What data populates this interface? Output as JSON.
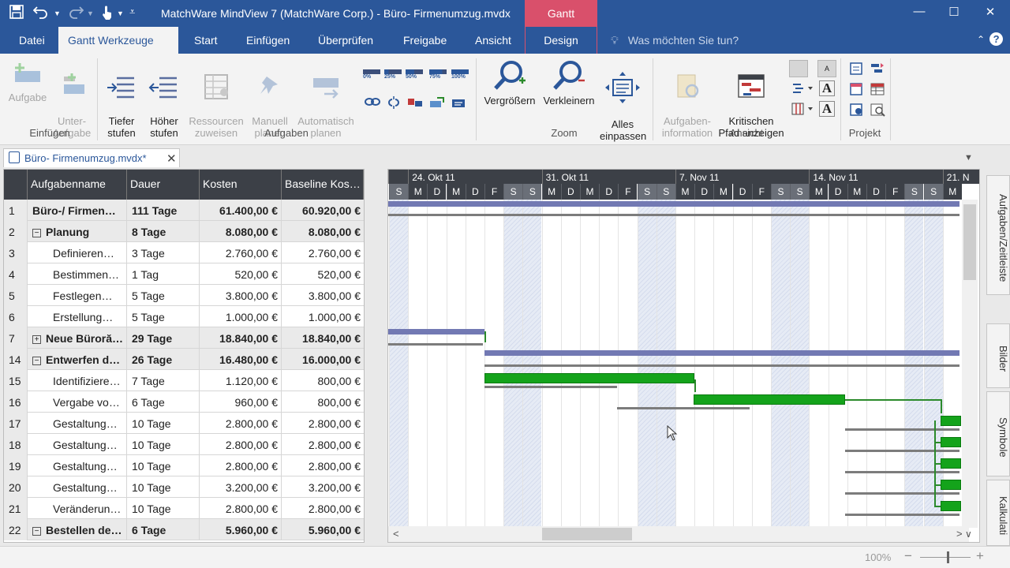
{
  "window": {
    "title": "MatchWare MindView 7 (MatchWare Corp.) - Büro- Firmenumzug.mvdx",
    "context_tab": "Gantt"
  },
  "ribbon_tabs": [
    "Datei",
    "Gantt Werkzeuge",
    "Start",
    "Einfügen",
    "Überprüfen",
    "Freigabe",
    "Ansicht",
    "Design"
  ],
  "active_tab": "Gantt Werkzeuge",
  "tell_me": "Was möchten Sie tun?",
  "ribbon": {
    "insert": {
      "label": "Einfügen",
      "task": "Aufgabe",
      "subtask": "Unter-\nAufgabe"
    },
    "tasks": {
      "label": "Aufgaben",
      "indent": "Tiefer\nstufen",
      "outdent": "Höher\nstufen",
      "assign": "Ressourcen\nzuweisen",
      "manual": "Manuell\nplanen",
      "auto": "Automatisch\nplanen",
      "progress": [
        "0%",
        "25%",
        "50%",
        "75%",
        "100%"
      ]
    },
    "zoom": {
      "label": "Zoom",
      "zoom_in": "Vergrößern",
      "zoom_out": "Verkleinern",
      "fit": "Alles\neinpassen"
    },
    "view": {
      "label": "Ansicht",
      "task_info": "Aufgaben-\ninformation",
      "critical": "Kritischen\nPfad anzeigen"
    },
    "project": {
      "label": "Projekt"
    }
  },
  "document_tab": "Büro- Firmenumzug.mvdx*",
  "grid": {
    "headers": [
      "Aufgabenname",
      "Dauer",
      "Kosten",
      "Baseline  Kos…"
    ],
    "rows": [
      {
        "id": "1",
        "name": "Büro-/ Firmen…",
        "duration": "111 Tage",
        "cost": "61.400,00 €",
        "baseline": "60.920,00 €",
        "summary": true,
        "exp": ""
      },
      {
        "id": "2",
        "name": "Planung",
        "duration": "8 Tage",
        "cost": "8.080,00 €",
        "baseline": "8.080,00 €",
        "summary": true,
        "exp": "−"
      },
      {
        "id": "3",
        "name": "Definieren…",
        "duration": "3 Tage",
        "cost": "2.760,00 €",
        "baseline": "2.760,00 €",
        "summary": false,
        "exp": ""
      },
      {
        "id": "4",
        "name": "Bestimmen…",
        "duration": "1 Tag",
        "cost": "520,00 €",
        "baseline": "520,00 €",
        "summary": false,
        "exp": ""
      },
      {
        "id": "5",
        "name": "Festlegen…",
        "duration": "5 Tage",
        "cost": "3.800,00 €",
        "baseline": "3.800,00 €",
        "summary": false,
        "exp": ""
      },
      {
        "id": "6",
        "name": "Erstellung…",
        "duration": "5 Tage",
        "cost": "1.000,00 €",
        "baseline": "1.000,00 €",
        "summary": false,
        "exp": ""
      },
      {
        "id": "7",
        "name": "Neue Büroră…",
        "duration": "29 Tage",
        "cost": "18.840,00 €",
        "baseline": "18.840,00 €",
        "summary": true,
        "exp": "+"
      },
      {
        "id": "14",
        "name": "Entwerfen d…",
        "duration": "26 Tage",
        "cost": "16.480,00 €",
        "baseline": "16.000,00 €",
        "summary": true,
        "exp": "−"
      },
      {
        "id": "15",
        "name": "Identifiziere…",
        "duration": "7 Tage",
        "cost": "1.120,00 €",
        "baseline": "800,00 €",
        "summary": false,
        "exp": ""
      },
      {
        "id": "16",
        "name": "Vergabe vo…",
        "duration": "6 Tage",
        "cost": "960,00 €",
        "baseline": "800,00 €",
        "summary": false,
        "exp": ""
      },
      {
        "id": "17",
        "name": "Gestaltung…",
        "duration": "10 Tage",
        "cost": "2.800,00 €",
        "baseline": "2.800,00 €",
        "summary": false,
        "exp": ""
      },
      {
        "id": "18",
        "name": "Gestaltung…",
        "duration": "10 Tage",
        "cost": "2.800,00 €",
        "baseline": "2.800,00 €",
        "summary": false,
        "exp": ""
      },
      {
        "id": "19",
        "name": "Gestaltung…",
        "duration": "10 Tage",
        "cost": "2.800,00 €",
        "baseline": "2.800,00 €",
        "summary": false,
        "exp": ""
      },
      {
        "id": "20",
        "name": "Gestaltung…",
        "duration": "10 Tage",
        "cost": "3.200,00 €",
        "baseline": "3.200,00 €",
        "summary": false,
        "exp": ""
      },
      {
        "id": "21",
        "name": "Veränderun…",
        "duration": "10 Tage",
        "cost": "2.800,00 €",
        "baseline": "2.800,00 €",
        "summary": false,
        "exp": ""
      },
      {
        "id": "22",
        "name": "Bestellen de…",
        "duration": "6 Tage",
        "cost": "5.960,00 €",
        "baseline": "5.960,00 €",
        "summary": true,
        "exp": "−"
      }
    ]
  },
  "gantt": {
    "weeks": [
      "24. Okt 11",
      "31. Okt 11",
      "7. Nov 11",
      "14. Nov 11",
      "21. N"
    ],
    "days": [
      "S",
      "M",
      "D",
      "M",
      "D",
      "F",
      "S",
      "S",
      "M",
      "D",
      "M",
      "D",
      "F",
      "S",
      "S",
      "M",
      "D",
      "M",
      "D",
      "F",
      "S",
      "S",
      "M",
      "D",
      "M",
      "D",
      "F",
      "S",
      "S",
      "M"
    ],
    "weekend_flags": [
      1,
      0,
      0,
      0,
      0,
      0,
      1,
      1,
      0,
      0,
      0,
      0,
      0,
      1,
      1,
      0,
      0,
      0,
      0,
      0,
      1,
      1,
      0,
      0,
      0,
      0,
      0,
      1,
      1,
      0
    ]
  },
  "side_panel": [
    "Aufgaben/Zeitleiste",
    "Bilder",
    "Symbole",
    "Kalkulati"
  ],
  "status": {
    "zoom": "100%",
    "minus": "−",
    "plus": "+"
  },
  "icons": {
    "save": "save-icon",
    "undo": "undo-icon",
    "redo": "redo-icon",
    "touch": "touch-mode-icon",
    "customize": "customize-qat-icon"
  },
  "colors": {
    "accent": "#2b579a",
    "context": "#d9506b",
    "task_bar": "#14a31b",
    "summary_bar": "#7279b3"
  }
}
